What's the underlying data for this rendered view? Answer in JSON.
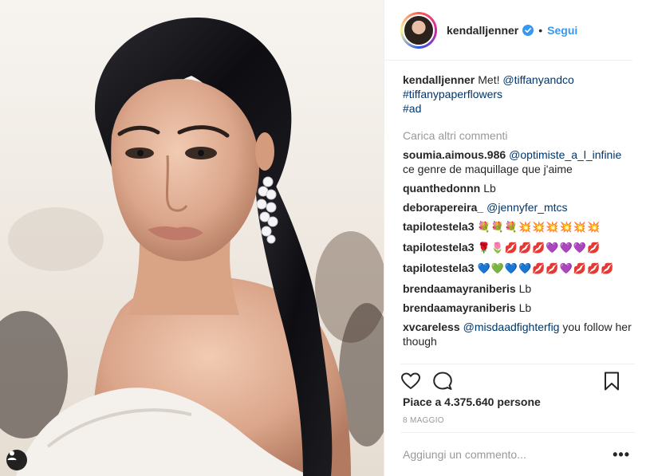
{
  "header": {
    "username": "kendalljenner",
    "follow_label": "Segui",
    "dot": "•"
  },
  "caption": {
    "username": "kendalljenner",
    "text": "Met! ",
    "mention": "@tiffanyandco",
    "hashtag1": "#tiffanypaperflowers",
    "hashtag2": "#ad"
  },
  "load_more": "Carica altri commenti",
  "comments": [
    {
      "user": "soumia.aimous.986",
      "mention": "@optimiste_a_l_infinie",
      "text": " ce genre de maquillage que j'aime"
    },
    {
      "user": "quanthedonnn",
      "mention": "",
      "text": "Lb"
    },
    {
      "user": "deborapereira_",
      "mention": "@jennyfer_mtcs",
      "text": ""
    },
    {
      "user": "tapilotestela3",
      "mention": "",
      "text": "💐💐💐💥💥💥💥💥💥"
    },
    {
      "user": "tapilotestela3",
      "mention": "",
      "text": "🌹🌷💋💋💋💜💜💜💋"
    },
    {
      "user": "tapilotestela3",
      "mention": "",
      "text": "💙💚💙💙💋💋💜💋💋💋"
    },
    {
      "user": "brendaamayraniberis",
      "mention": "",
      "text": "Lb"
    },
    {
      "user": "brendaamayraniberis",
      "mention": "",
      "text": "Lb"
    },
    {
      "user": "xvcareless",
      "mention": "@misdaadfighterfig",
      "text": " you follow her though"
    }
  ],
  "likes": "Piace a 4.375.640 persone",
  "date": "8 MAGGIO",
  "comment_input": {
    "placeholder": "Aggiungi un commento...",
    "value": ""
  },
  "more_label": "•••",
  "icons": {
    "like": "heart-icon",
    "comment": "comment-icon",
    "save": "bookmark-icon",
    "tagged": "user-tag-icon",
    "verified": "verified-badge-icon",
    "more": "more-options-icon"
  },
  "colors": {
    "link_blue": "#3897f0",
    "mention_blue": "#003569",
    "muted": "#999999",
    "text": "#262626",
    "border": "#efefef"
  }
}
